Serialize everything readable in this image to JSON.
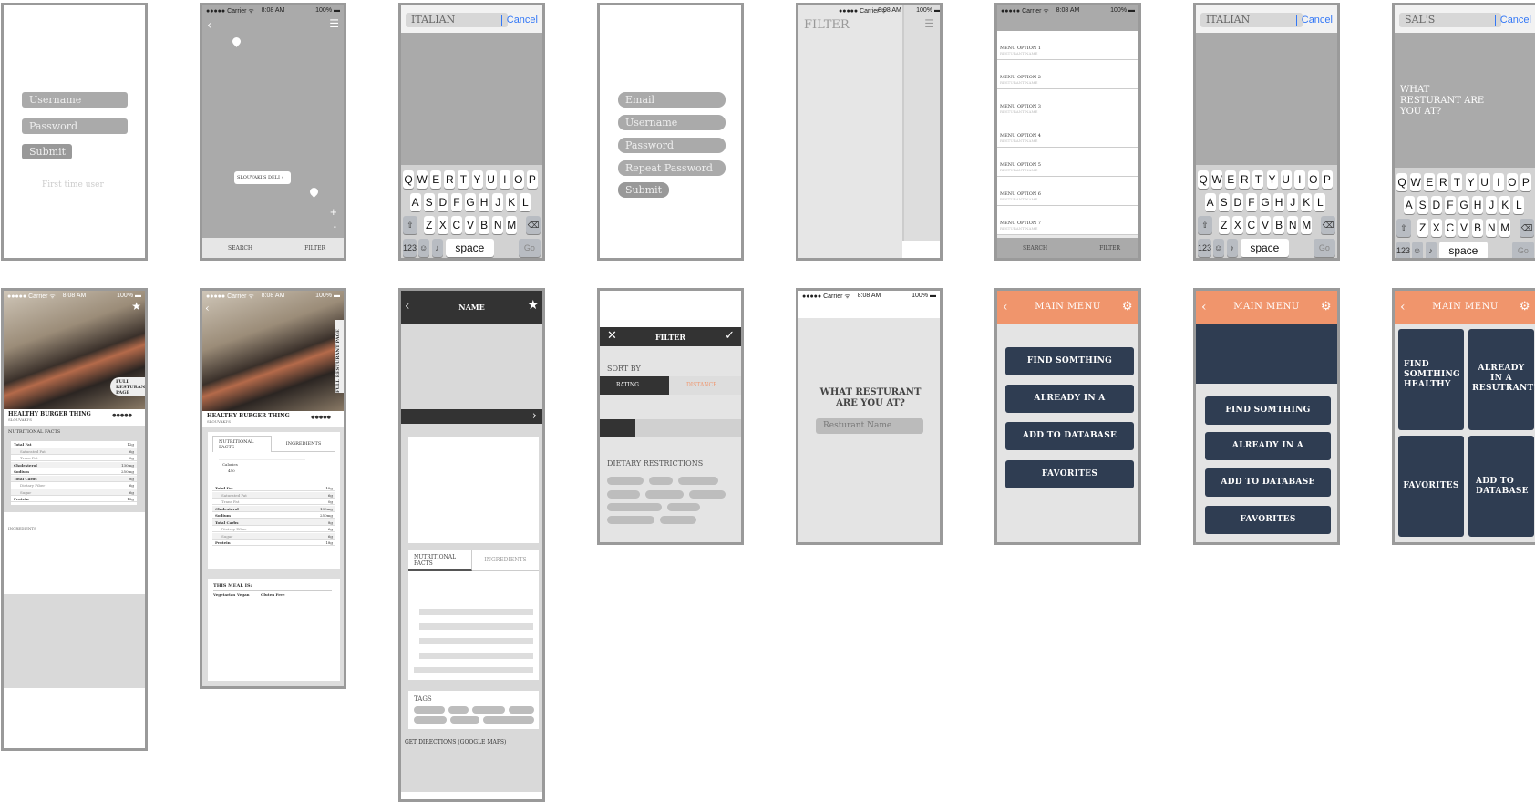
{
  "status": {
    "carrier": "●●●●● Carrier ᯤ",
    "time": "8:08 AM",
    "battery": "100% ▬"
  },
  "login": {
    "username": "Username",
    "password": "Password",
    "submit": "Submit",
    "first_time": "First time user"
  },
  "map": {
    "pin_label": "SLOUVAKI'S DELI",
    "search": "SEARCH",
    "filter": "FILTER",
    "plus": "+",
    "minus": "-"
  },
  "keyboard": {
    "row1": [
      "Q",
      "W",
      "E",
      "R",
      "T",
      "Y",
      "U",
      "I",
      "O",
      "P"
    ],
    "row2": [
      "A",
      "S",
      "D",
      "F",
      "G",
      "H",
      "J",
      "K",
      "L"
    ],
    "row3": [
      "Z",
      "X",
      "C",
      "V",
      "B",
      "N",
      "M"
    ],
    "num": "123",
    "space": "space",
    "go": "Go"
  },
  "search1": {
    "value": "ITALIAN",
    "cancel": "Cancel"
  },
  "register": {
    "email": "Email",
    "username": "Username",
    "password": "Password",
    "repeat": "Repeat Password",
    "submit": "Submit"
  },
  "filter_drawer": {
    "title": "FILTER"
  },
  "menu_list": {
    "items": [
      {
        "label": "MENU OPTION 1",
        "sub": "RESTURANT NAME"
      },
      {
        "label": "MENU OPTION 2",
        "sub": "RESTURANT NAME"
      },
      {
        "label": "MENU OPTION 3",
        "sub": "RESTURANT NAME"
      },
      {
        "label": "MENU OPTION 4",
        "sub": "RESTURANT NAME"
      },
      {
        "label": "MENU OPTION 5",
        "sub": "RESTURANT NAME"
      },
      {
        "label": "MENU OPTION 6",
        "sub": "RESTURANT NAME"
      },
      {
        "label": "MENU OPTION 7",
        "sub": "RESTURANT NAME"
      }
    ],
    "search": "SEARCH",
    "filter": "FILTER"
  },
  "search2": {
    "value": "ITALIAN",
    "cancel": "Cancel"
  },
  "search3": {
    "value": "SAL'S",
    "cancel": "Cancel",
    "prompt": "WHAT RESTURANT ARE YOU AT?"
  },
  "detail1": {
    "name": "HEALTHY BURGER THING",
    "sub": "SLOUVAKI'S",
    "rating": "●●●●●",
    "full_page": "FULL RESTURANT PAGE",
    "nutri_title": "NUTRITIONAL FACTS",
    "ingredients": "INGREDIENTS",
    "rows": [
      {
        "k": "Total Fat",
        "v": "12g",
        "b": true
      },
      {
        "k": "Saturated Fat",
        "v": "6g",
        "b": false
      },
      {
        "k": "Trans Fat",
        "v": "0g",
        "b": false
      },
      {
        "k": "Cholesterol",
        "v": "130mg",
        "b": true
      },
      {
        "k": "Sodium",
        "v": "250mg",
        "b": true
      },
      {
        "k": "Total Carbs",
        "v": "8g",
        "b": true
      },
      {
        "k": "Dietary Fiber",
        "v": "6g",
        "b": false
      },
      {
        "k": "Sugar",
        "v": "6g",
        "b": false
      },
      {
        "k": "Protein",
        "v": "18g",
        "b": true
      }
    ]
  },
  "detail2": {
    "name": "HEALTHY BURGER THING",
    "sub": "SLOUVAKI'S",
    "rating": "●●●●●",
    "full_page": "FULL RESTURANT PAGE",
    "tab1": "NUTRITIONAL FACTS",
    "tab2": "INGREDIENTS",
    "calories_label": "Calories",
    "calories": "450",
    "meal_is": "THIS MEAL IS:",
    "tags": [
      "Vegetarian",
      "Vegan",
      "Gluten Free"
    ]
  },
  "resto": {
    "name": "NAME",
    "tab1": "NUTRITIONAL FACTS",
    "tab2": "INGREDIENTS",
    "tags": "TAGS",
    "directions": "GET DIRECTIONS (GOOGLE MAPS)"
  },
  "filter": {
    "title": "FILTER",
    "sort_by": "SORT BY",
    "rating": "RATING",
    "distance": "DISTANCE",
    "dietary": "DIETARY RESTRICTIONS",
    "slider_fraction": 0.25
  },
  "which": {
    "prompt": "WHAT RESTURANT ARE YOU AT?",
    "placeholder": "Resturant Name"
  },
  "menu1": {
    "title": "MAIN MENU",
    "buttons": [
      "FIND SOMTHING HEALTHY",
      "ALREADY IN A RESTURANT?",
      "ADD TO DATABASE",
      "FAVORITES"
    ]
  },
  "menu2": {
    "title": "MAIN MENU",
    "buttons": [
      "FIND SOMTHING HEALTHY",
      "ALREADY IN A RESTURANT?",
      "ADD TO DATABASE",
      "FAVORITES"
    ]
  },
  "menu3": {
    "title": "MAIN MENU",
    "tiles": [
      "FIND SOMTHING HEALTHY",
      "ALREADY IN A RESUTRANT?",
      "FAVORITES",
      "ADD TO DATABASE"
    ]
  },
  "colors": {
    "accent": "#f0956c",
    "navy": "#2f3d52",
    "wire": "#aaaaaa"
  }
}
